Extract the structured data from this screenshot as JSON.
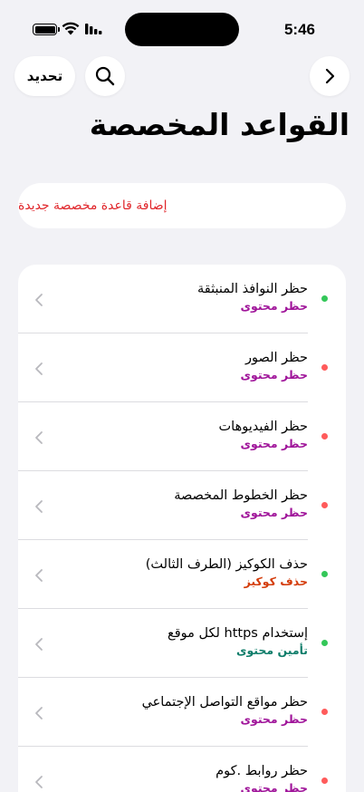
{
  "status_bar": {
    "time": "5:46"
  },
  "header": {
    "refresh_label": "تحديد",
    "title": "القواعد المخصصة"
  },
  "add_rule": {
    "label": "إضافة قاعدة مخصصة جديدة"
  },
  "colors": {
    "accent_red": "#e0252a",
    "status_green": "#34c759",
    "status_red": "#ff5b5b",
    "category_purple": "#a0159a",
    "category_orange": "#d43d0c",
    "category_teal": "#0f7d6a"
  },
  "icons": {
    "search": "search-icon",
    "back": "chevron-right-icon",
    "row_chevron": "chevron-left-icon"
  },
  "rules": [
    {
      "title": "حظر النوافذ المنبثقة",
      "category": "حظر محتوى",
      "status": "enabled",
      "dot_color": "#34c759",
      "category_color": "#a0159a"
    },
    {
      "title": "حظر الصور",
      "category": "حظر محتوى",
      "status": "disabled",
      "dot_color": "#ff5b5b",
      "category_color": "#a0159a"
    },
    {
      "title": "حظر الفيديوهات",
      "category": "حظر محتوى",
      "status": "disabled",
      "dot_color": "#ff5b5b",
      "category_color": "#a0159a"
    },
    {
      "title": "حظر الخطوط المخصصة",
      "category": "حظر محتوى",
      "status": "disabled",
      "dot_color": "#ff5b5b",
      "category_color": "#a0159a"
    },
    {
      "title": "حذف الكوكيز (الطرف الثالث)",
      "category": "حذف كوكيز",
      "status": "enabled",
      "dot_color": "#34c759",
      "category_color": "#d43d0c"
    },
    {
      "title": "إستخدام https لكل موقع",
      "category": "تأمين محتوى",
      "status": "enabled",
      "dot_color": "#34c759",
      "category_color": "#0f7d6a"
    },
    {
      "title": "حظر مواقع التواصل الإجتماعي",
      "category": "حظر محتوى",
      "status": "disabled",
      "dot_color": "#ff5b5b",
      "category_color": "#a0159a"
    },
    {
      "title": "حظر روابط .كوم",
      "category": "حظر محتوى",
      "status": "disabled",
      "dot_color": "#ff5b5b",
      "category_color": "#a0159a"
    }
  ]
}
